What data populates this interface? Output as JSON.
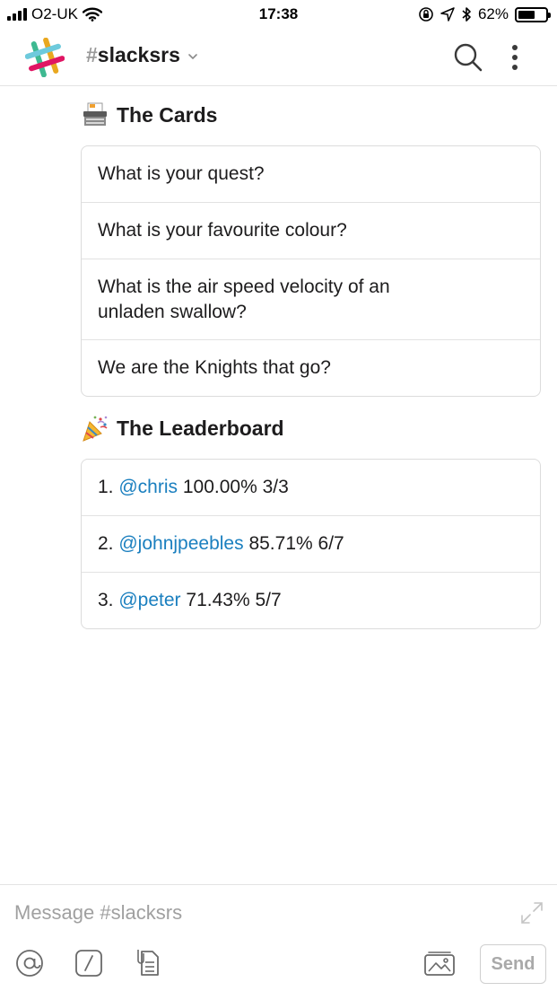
{
  "status_bar": {
    "carrier": "O2-UK",
    "time": "17:38",
    "battery_percent": "62%",
    "battery_level": 0.62
  },
  "header": {
    "channel_prefix": "#",
    "channel_name": "slacksrs"
  },
  "cards_section": {
    "title": "The Cards",
    "emoji": "card-file-box-icon",
    "items": [
      "What is your quest?",
      "What is your favourite colour?",
      "What is the air speed velocity of an unladen swallow?",
      "We are the Knights that go?"
    ]
  },
  "leaderboard_section": {
    "title": "The Leaderboard",
    "emoji": "party-popper-icon",
    "entries": [
      {
        "rank": "1.",
        "user": "@chris",
        "score": "100.00% 3/3"
      },
      {
        "rank": "2.",
        "user": "@johnjpeebles",
        "score": "85.71% 6/7"
      },
      {
        "rank": "3.",
        "user": "@peter",
        "score": "71.43% 5/7"
      }
    ]
  },
  "composer": {
    "placeholder": "Message #slacksrs",
    "value": "",
    "send_label": "Send"
  },
  "colors": {
    "mention": "#1a7fbf",
    "border": "#dcdcdc",
    "muted": "#a0a0a0"
  }
}
